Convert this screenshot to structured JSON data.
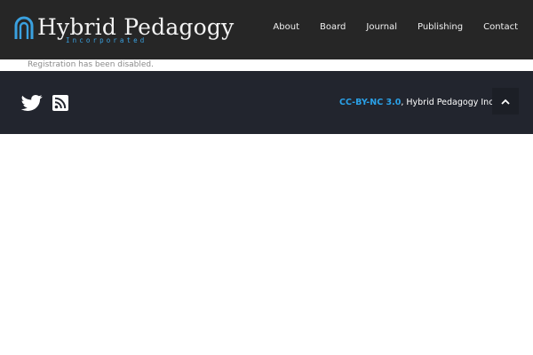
{
  "header": {
    "logo": {
      "title": "Hybrid Pedagogy",
      "subtitle": "Incorporated",
      "icon": "arch-logo-icon"
    },
    "nav": [
      {
        "label": "About"
      },
      {
        "label": "Board"
      },
      {
        "label": "Journal"
      },
      {
        "label": "Publishing"
      },
      {
        "label": "Contact"
      }
    ]
  },
  "notice": {
    "text": "Registration has been disabled."
  },
  "footer": {
    "social": [
      {
        "icon": "twitter-icon"
      },
      {
        "icon": "rss-icon"
      }
    ],
    "credit": {
      "license": "CC-BY-NC 3.0",
      "separator": ",",
      "owner": "Hybrid Pedagogy Inc."
    },
    "back_to_top_icon": "chevron-up-icon"
  },
  "colors": {
    "header_bg": "#262626",
    "footer_bg": "#22252e",
    "accent": "#2aa1e8"
  }
}
